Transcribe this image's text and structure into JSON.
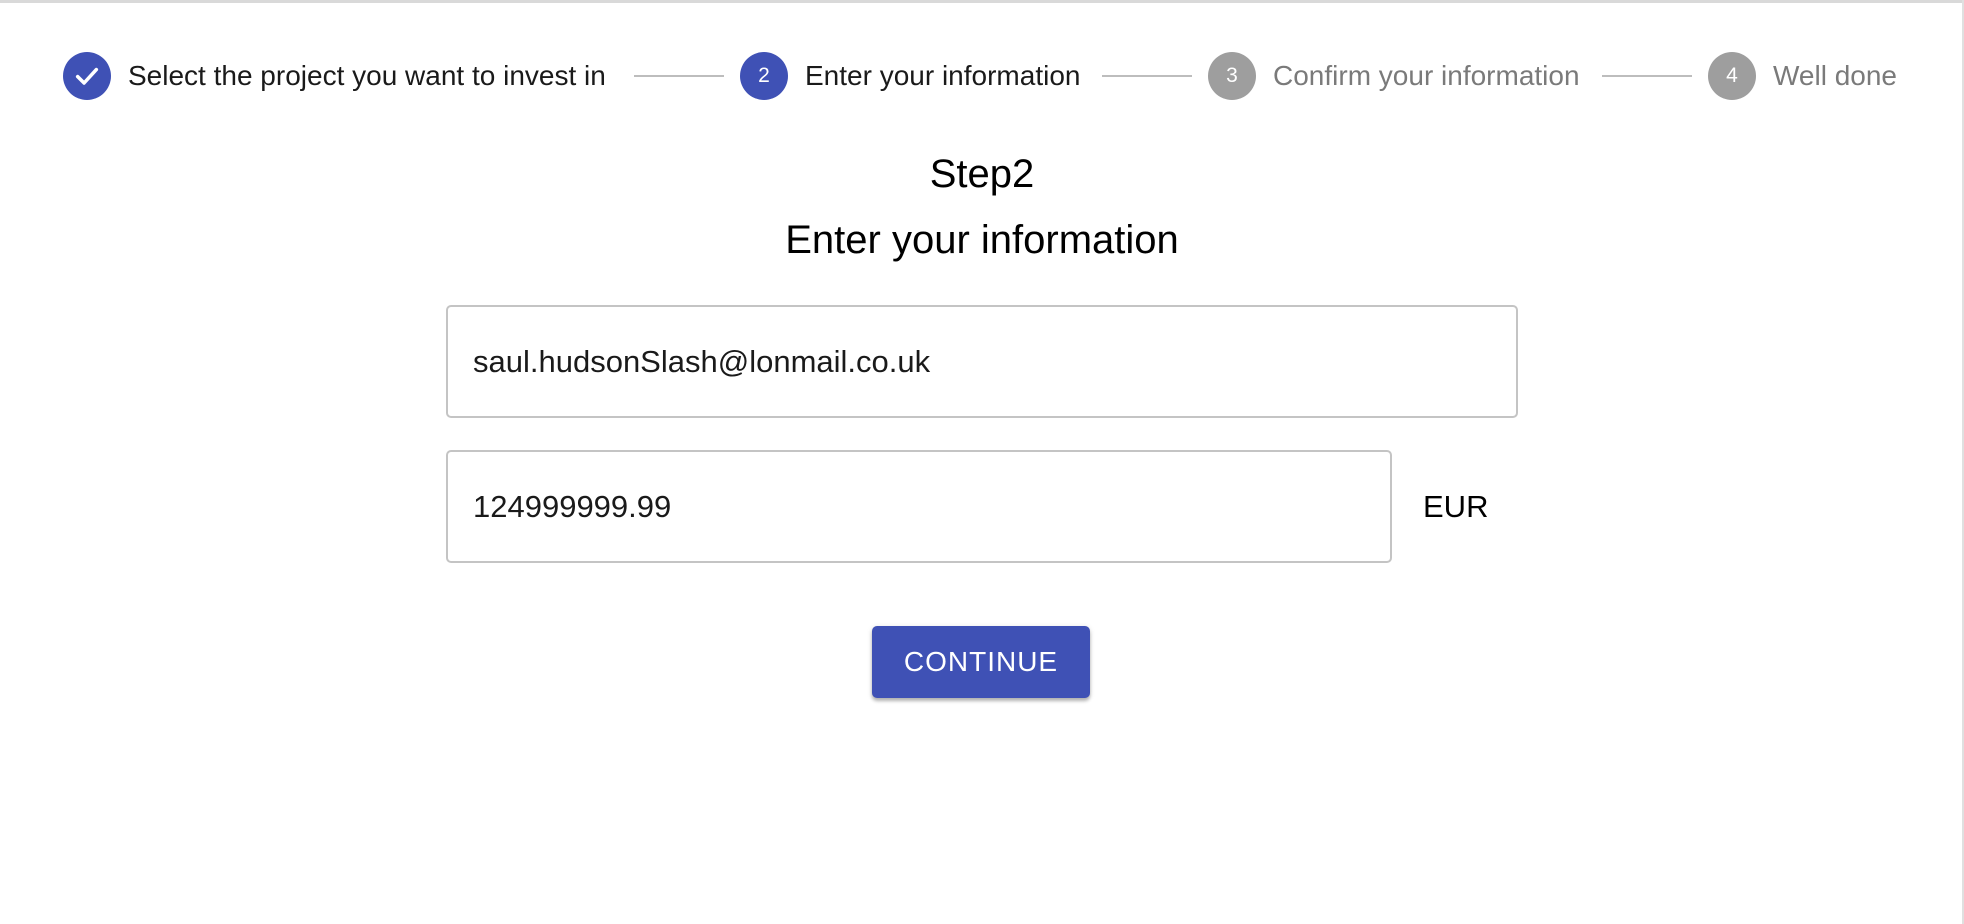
{
  "stepper": {
    "steps": [
      {
        "number": "",
        "label": "Select the project you want to invest in",
        "state": "completed",
        "icon": "check-icon"
      },
      {
        "number": "2",
        "label": "Enter your information",
        "state": "active"
      },
      {
        "number": "3",
        "label": "Confirm your information",
        "state": "pending"
      },
      {
        "number": "4",
        "label": "Well done",
        "state": "pending"
      }
    ]
  },
  "main": {
    "step_heading": "Step2",
    "title": "Enter your information",
    "email": {
      "value": "saul.hudsonSlash@lonmail.co.uk"
    },
    "amount": {
      "value": "124999999.99",
      "currency": "EUR"
    },
    "continue_label": "CONTINUE"
  },
  "colors": {
    "primary": "#3f51b5",
    "inactive_step": "#9e9e9e",
    "inactive_text": "#7a7a7a",
    "connector": "#bdbdbd",
    "field_border": "#c4c4c4"
  }
}
